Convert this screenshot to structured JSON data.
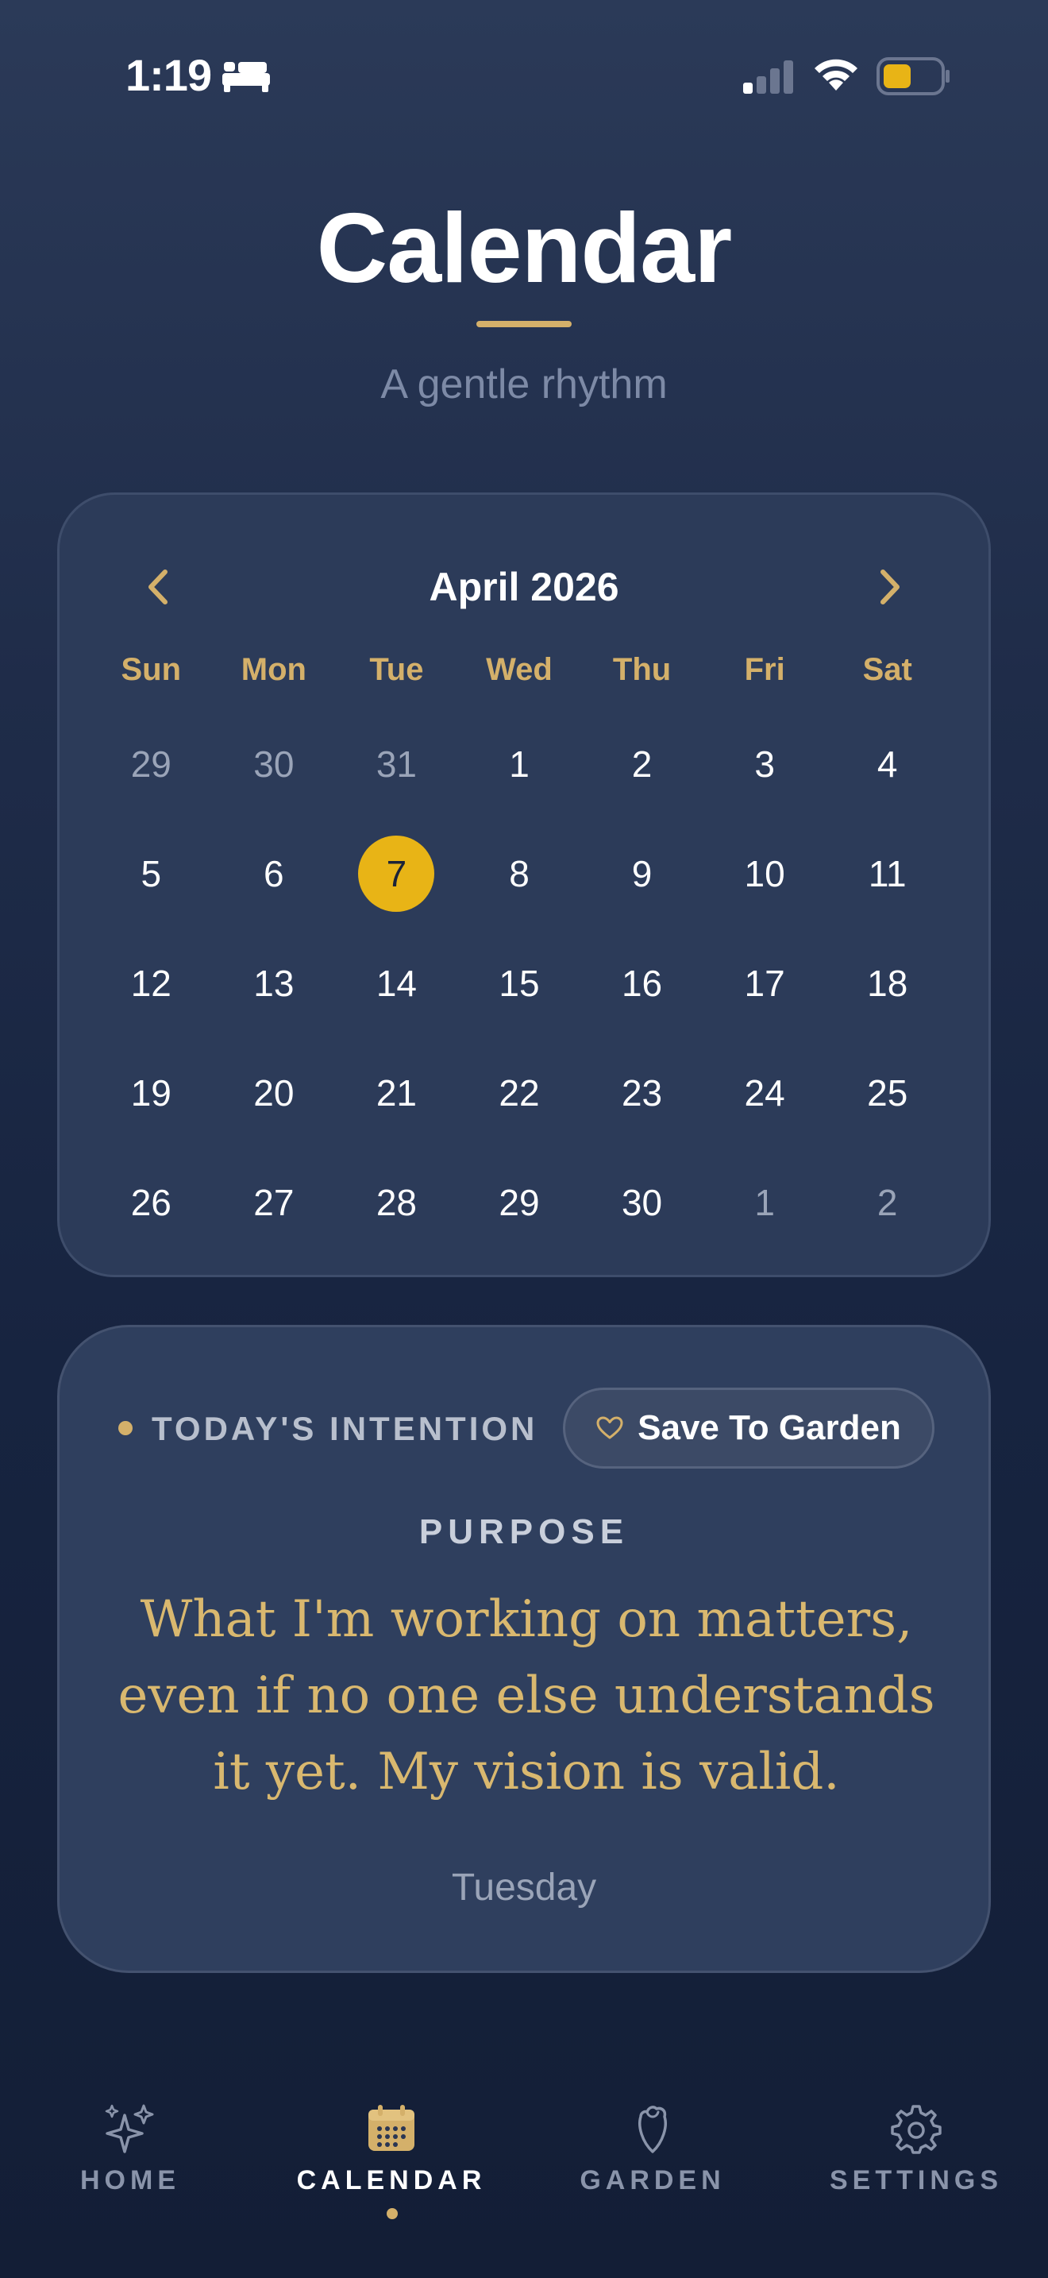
{
  "status": {
    "time": "1:19"
  },
  "header": {
    "title": "Calendar",
    "subtitle": "A gentle rhythm"
  },
  "calendar": {
    "month_label": "April 2026",
    "weekdays": [
      "Sun",
      "Mon",
      "Tue",
      "Wed",
      "Thu",
      "Fri",
      "Sat"
    ],
    "days": [
      {
        "label": "29",
        "muted": true
      },
      {
        "label": "30",
        "muted": true
      },
      {
        "label": "31",
        "muted": true
      },
      {
        "label": "1"
      },
      {
        "label": "2"
      },
      {
        "label": "3"
      },
      {
        "label": "4"
      },
      {
        "label": "5"
      },
      {
        "label": "6"
      },
      {
        "label": "7",
        "today": true
      },
      {
        "label": "8"
      },
      {
        "label": "9"
      },
      {
        "label": "10"
      },
      {
        "label": "11"
      },
      {
        "label": "12"
      },
      {
        "label": "13"
      },
      {
        "label": "14"
      },
      {
        "label": "15"
      },
      {
        "label": "16"
      },
      {
        "label": "17"
      },
      {
        "label": "18"
      },
      {
        "label": "19"
      },
      {
        "label": "20"
      },
      {
        "label": "21"
      },
      {
        "label": "22"
      },
      {
        "label": "23"
      },
      {
        "label": "24"
      },
      {
        "label": "25"
      },
      {
        "label": "26"
      },
      {
        "label": "27"
      },
      {
        "label": "28"
      },
      {
        "label": "29"
      },
      {
        "label": "30"
      },
      {
        "label": "1",
        "muted": true
      },
      {
        "label": "2",
        "muted": true
      }
    ]
  },
  "intention": {
    "label": "TODAY'S INTENTION",
    "save_label": "Save To Garden",
    "category": "PURPOSE",
    "quote": "What I'm working on matters, even if no one else understands it yet. My vision is valid.",
    "day": "Tuesday"
  },
  "nav": {
    "items": [
      {
        "label": "HOME",
        "icon": "sparkles-icon"
      },
      {
        "label": "CALENDAR",
        "icon": "calendar-icon",
        "active": true
      },
      {
        "label": "GARDEN",
        "icon": "rose-icon"
      },
      {
        "label": "SETTINGS",
        "icon": "gear-icon"
      }
    ]
  },
  "colors": {
    "accent": "#d4b06a",
    "today": "#e8b416",
    "card": "#2c3b59"
  }
}
